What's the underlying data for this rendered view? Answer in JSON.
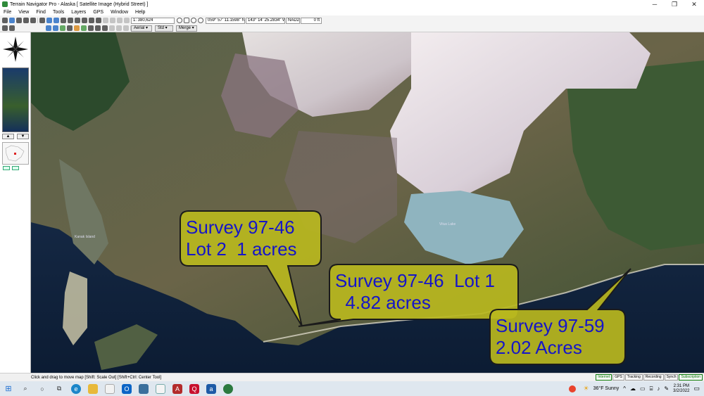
{
  "window": {
    "title": "Terrain Navigator Pro - Alaska [ Satellite Image (Hybrid Street) ]",
    "minimize": "─",
    "maximize": "❐",
    "close": "✕"
  },
  "menu": [
    "File",
    "View",
    "Find",
    "Tools",
    "Layers",
    "GPS",
    "Window",
    "Help"
  ],
  "toolbar": {
    "scale": "1: 380,624",
    "latitude": "059° 57' 11.1598\" N",
    "longitude": "143° 14' 25.2834\" W",
    "datum": "NAD27",
    "elevation": "0 ft",
    "imagery_select": "Aerial",
    "std_select": "Std",
    "merge_select": "Merge"
  },
  "map": {
    "labels": {
      "lake": "Vitus Lake",
      "island": "Kanak Island"
    },
    "bubbles": [
      {
        "line1": "Survey 97-46",
        "line2": "Lot 2  1 acres"
      },
      {
        "line1": "Survey 97-46  Lot 1",
        "line2": "  4.82 acres"
      },
      {
        "line1": "Survey 97-59",
        "line2": "2.02 Acres"
      }
    ],
    "bubble_fill": "#b9b71e",
    "text_color": "#1515c8"
  },
  "status": {
    "hint": "Click and drag to move map [Shift: Scale Out] [Shift+Ctrl: Center Tool]",
    "indicators": [
      "Internet",
      "GPS",
      "Tracking",
      "Recording",
      "Synch",
      "Subscription"
    ]
  },
  "taskbar": {
    "weather": "36°F  Sunny",
    "time": "2:31 PM",
    "date": "3/2/2022"
  }
}
